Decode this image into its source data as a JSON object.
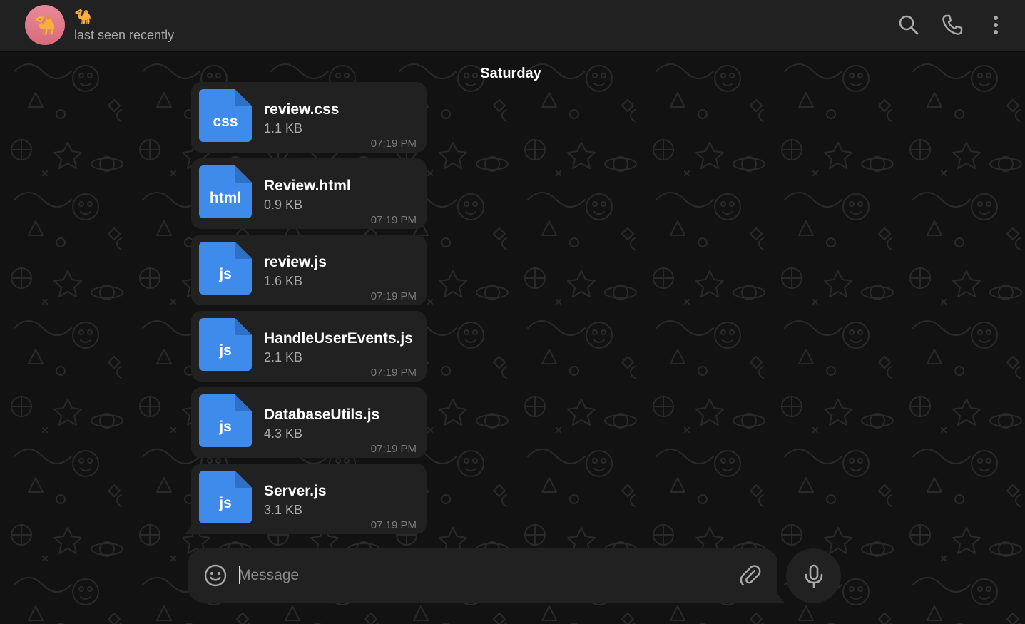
{
  "header": {
    "avatar_emoji": "🐪",
    "peer_name": "🐪",
    "peer_status": "last seen recently",
    "avatar_color": "#e07b8d",
    "icons": [
      "search-icon",
      "phone-icon",
      "more-vertical-icon"
    ]
  },
  "chat": {
    "date_label": "Saturday",
    "messages": [
      {
        "ext": "css",
        "name": "review.css",
        "size": "1.1 KB",
        "time": "07:19 PM"
      },
      {
        "ext": "html",
        "name": "Review.html",
        "size": "0.9 KB",
        "time": "07:19 PM"
      },
      {
        "ext": "js",
        "name": "review.js",
        "size": "1.6 KB",
        "time": "07:19 PM"
      },
      {
        "ext": "js",
        "name": "HandleUserEvents.js",
        "size": "2.1 KB",
        "time": "07:19 PM"
      },
      {
        "ext": "js",
        "name": "DatabaseUtils.js",
        "size": "4.3 KB",
        "time": "07:19 PM"
      },
      {
        "ext": "js",
        "name": "Server.js",
        "size": "3.1 KB",
        "time": "07:19 PM"
      }
    ]
  },
  "composer": {
    "placeholder": "Message",
    "value": "",
    "icons": [
      "emoji-icon",
      "paperclip-icon",
      "microphone-icon"
    ]
  },
  "colors": {
    "background": "#121212",
    "bubble": "#212121",
    "file_icon": "#3f8bec",
    "muted_text": "#aaaaaa"
  }
}
